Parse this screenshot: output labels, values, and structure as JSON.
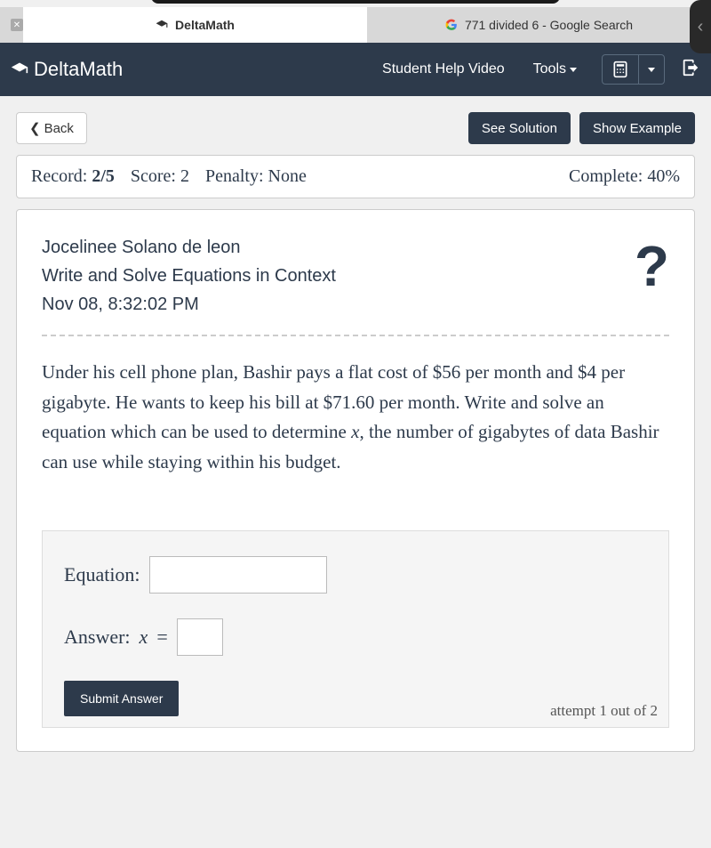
{
  "tabs": {
    "active": "DeltaMath",
    "inactive": "771 divided 6 - Google Search"
  },
  "navbar": {
    "brand": "DeltaMath",
    "help_video": "Student Help Video",
    "tools": "Tools"
  },
  "buttons": {
    "back": "Back",
    "see_solution": "See Solution",
    "show_example": "Show Example",
    "submit": "Submit Answer"
  },
  "status": {
    "record_label": "Record:",
    "record_value": "2/5",
    "score_label": "Score:",
    "score_value": "2",
    "penalty_label": "Penalty:",
    "penalty_value": "None",
    "complete_label": "Complete:",
    "complete_value": "40%"
  },
  "header": {
    "student": "Jocelinee Solano de leon",
    "topic": "Write and Solve Equations in Context",
    "timestamp": "Nov 08, 8:32:02 PM"
  },
  "problem": {
    "text_part1": "Under his cell phone plan, Bashir pays a flat cost of $56 per month and $4 per gigabyte. He wants to keep his bill at $71.60 per month. Write and solve an equation which can be used to determine ",
    "variable": "x",
    "text_part2": ", the number of gigabytes of data Bashir can use while staying within his budget."
  },
  "answer": {
    "equation_label": "Equation:",
    "answer_label": "Answer:",
    "answer_var": "x",
    "equals": "=",
    "attempt": "attempt 1 out of 2"
  }
}
